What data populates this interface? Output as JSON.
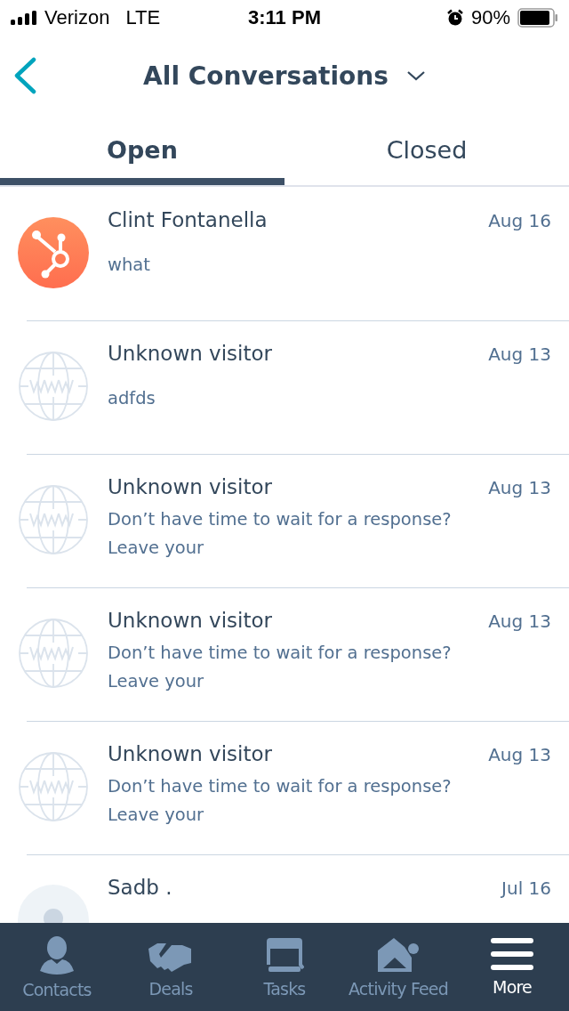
{
  "status_bar": {
    "carrier": "Verizon",
    "network": "LTE",
    "time": "3:11 PM",
    "battery": "90%"
  },
  "header": {
    "title": "All Conversations"
  },
  "tabs": [
    {
      "label": "Open",
      "selected": true
    },
    {
      "label": "Closed",
      "selected": false
    }
  ],
  "conversations": [
    {
      "avatar": {
        "kind": "brand"
      },
      "name": "Clint Fontanella",
      "date": "Aug 16",
      "preview": "what"
    },
    {
      "avatar": {
        "kind": "web"
      },
      "name": "Unknown visitor",
      "date": "Aug 13",
      "preview": "adfds"
    },
    {
      "avatar": {
        "kind": "web"
      },
      "name": "Unknown visitor",
      "date": "Aug 13",
      "preview": "Don’t have time to wait for a response? Leave your"
    },
    {
      "avatar": {
        "kind": "web"
      },
      "name": "Unknown visitor",
      "date": "Aug 13",
      "preview": "Don’t have time to wait for a response? Leave your"
    },
    {
      "avatar": {
        "kind": "web"
      },
      "name": "Unknown visitor",
      "date": "Aug 13",
      "preview": "Don’t have time to wait for a response? Leave your"
    },
    {
      "avatar": {
        "kind": "person"
      },
      "name": "Sadb .",
      "date": "Jul 16"
    }
  ],
  "nav": [
    {
      "label": "Contacts",
      "selected": false
    },
    {
      "label": "Deals",
      "selected": false
    },
    {
      "label": "Tasks",
      "selected": false
    },
    {
      "label": "Activity Feed",
      "selected": false
    },
    {
      "label": "More",
      "selected": true
    }
  ]
}
